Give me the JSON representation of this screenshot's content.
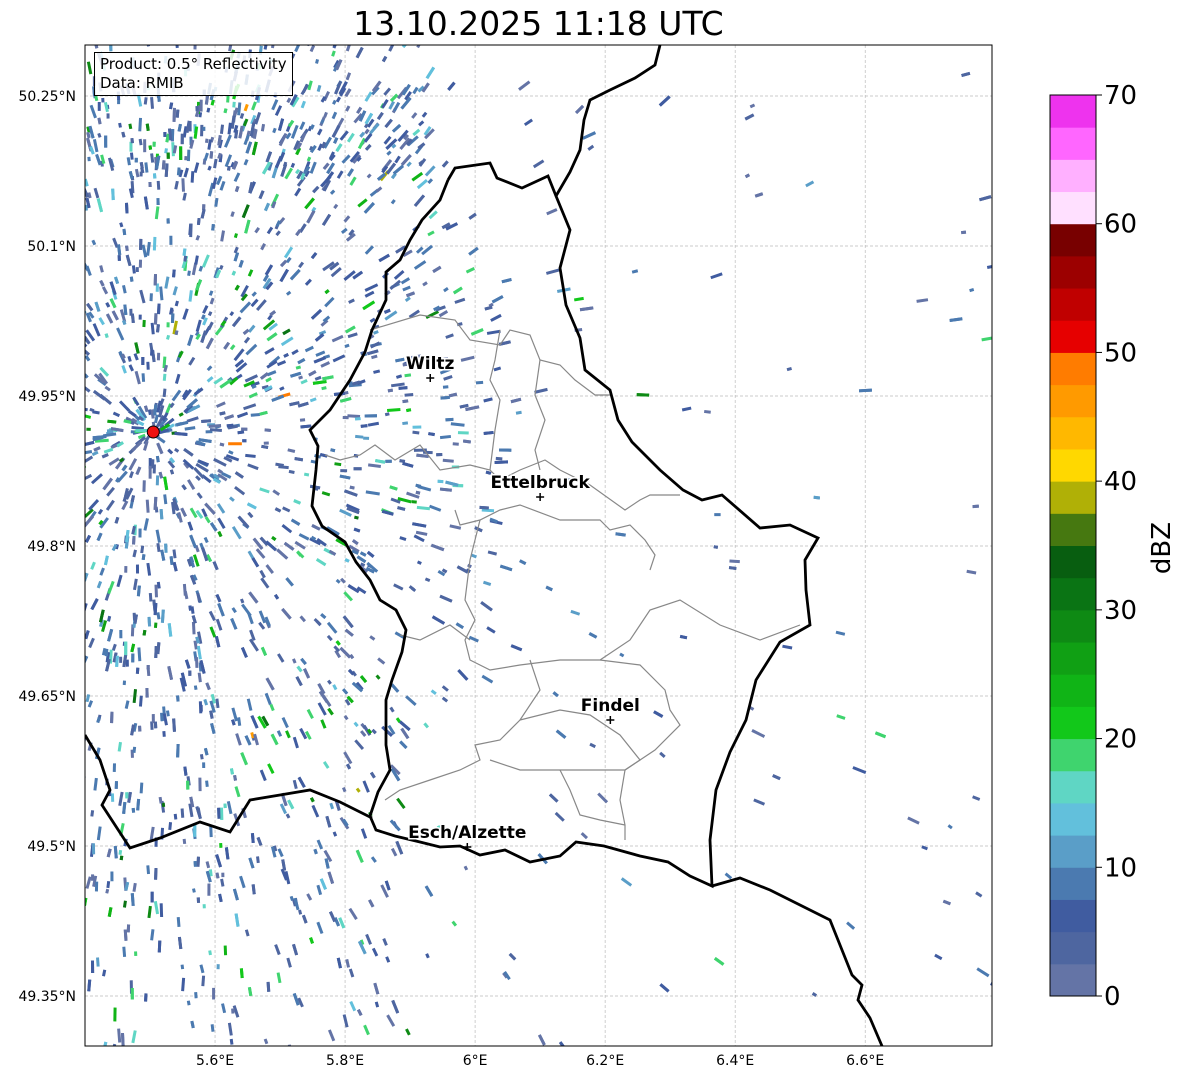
{
  "title": "13.10.2025 11:18 UTC",
  "info": {
    "product": "Product: 0.5° Reflectivity",
    "data": "Data: RMIB"
  },
  "map": {
    "lon_range": [
      5.4,
      6.795
    ],
    "lat_range": [
      49.3,
      50.301
    ],
    "lon_ticks": [
      {
        "v": 5.6,
        "label": "5.6°E"
      },
      {
        "v": 5.8,
        "label": "5.8°E"
      },
      {
        "v": 6.0,
        "label": "6°E"
      },
      {
        "v": 6.2,
        "label": "6.2°E"
      },
      {
        "v": 6.4,
        "label": "6.4°E"
      },
      {
        "v": 6.6,
        "label": "6.6°E"
      }
    ],
    "lat_ticks": [
      {
        "v": 50.25,
        "label": "50.25°N"
      },
      {
        "v": 50.1,
        "label": "50.1°N"
      },
      {
        "v": 49.95,
        "label": "49.95°N"
      },
      {
        "v": 49.8,
        "label": "49.8°N"
      },
      {
        "v": 49.65,
        "label": "49.65°N"
      },
      {
        "v": 49.5,
        "label": "49.5°N"
      },
      {
        "v": 49.35,
        "label": "49.35°N"
      }
    ],
    "radar_site": {
      "lon": 5.505,
      "lat": 49.914,
      "color": "#ee1111"
    },
    "cities": [
      {
        "name": "Wiltz",
        "lon": 5.931,
        "lat": 49.968
      },
      {
        "name": "Ettelbruck",
        "lon": 6.1,
        "lat": 49.849
      },
      {
        "name": "Findel",
        "lon": 6.208,
        "lat": 49.626
      },
      {
        "name": "Esch/Alzette",
        "lon": 5.988,
        "lat": 49.499
      }
    ]
  },
  "colorbar": {
    "label": "dBZ",
    "min": 0,
    "max": 70,
    "step": 2.5,
    "ticks": [
      "0",
      "10",
      "20",
      "30",
      "40",
      "50",
      "60",
      "70"
    ],
    "colors": [
      "#6474a6",
      "#4e66a0",
      "#405ca0",
      "#4b7ab0",
      "#5a9ec8",
      "#62c0dc",
      "#5fd6c4",
      "#3fd46e",
      "#12c81a",
      "#10b416",
      "#10a014",
      "#0e8a14",
      "#0a7414",
      "#085e10",
      "#467810",
      "#b0b006",
      "#ffd800",
      "#ffb800",
      "#ff9a00",
      "#ff7c00",
      "#e60000",
      "#c00000",
      "#9c0000",
      "#780000",
      "#ffe0ff",
      "#ffb0ff",
      "#ff66ff",
      "#ee33ee"
    ]
  }
}
